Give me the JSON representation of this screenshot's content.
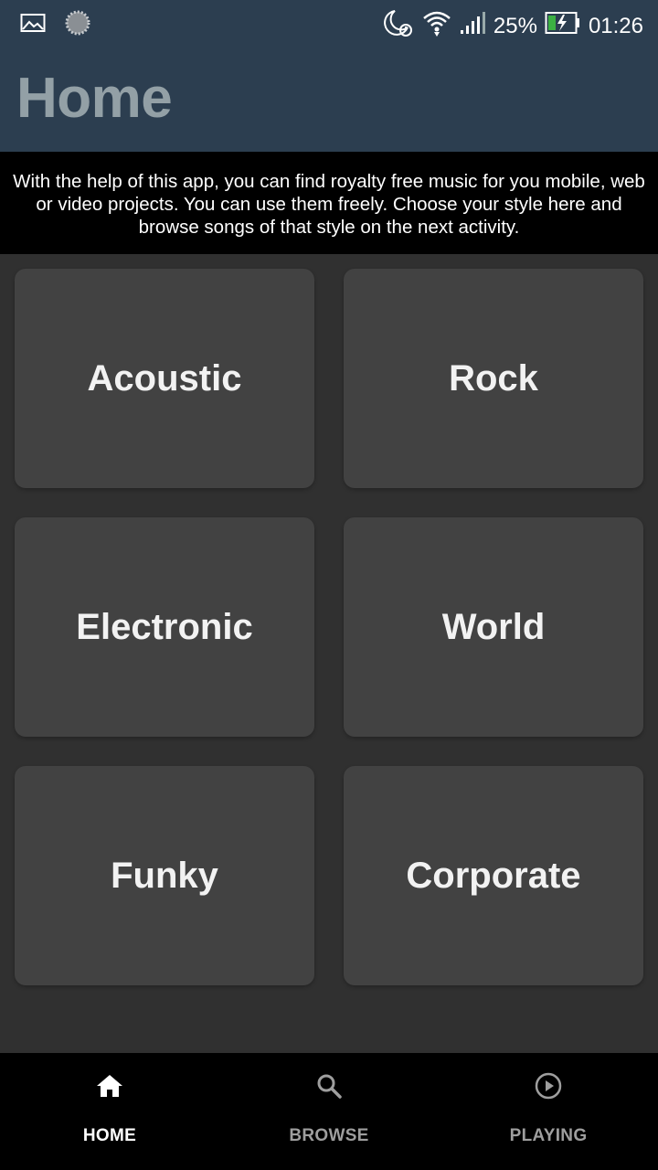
{
  "status_bar": {
    "battery": "25%",
    "time": "01:26",
    "icons": [
      "image-icon",
      "sync-icon",
      "moon-alarm-icon",
      "wifi-icon",
      "signal-icon",
      "battery-charging-icon"
    ]
  },
  "app_bar": {
    "title": "Home"
  },
  "intro_text": "With the help of this app, you can find royalty free music for you mobile, web or video projects. You can use them freely. Choose your style here and browse songs of that style on the next activity.",
  "genres": [
    {
      "label": "Acoustic"
    },
    {
      "label": "Rock"
    },
    {
      "label": "Electronic"
    },
    {
      "label": "World"
    },
    {
      "label": "Funky"
    },
    {
      "label": "Corporate"
    }
  ],
  "bottom_nav": {
    "items": [
      {
        "label": "HOME",
        "icon": "home-icon",
        "active": true
      },
      {
        "label": "BROWSE",
        "icon": "search-icon",
        "active": false
      },
      {
        "label": "PLAYING",
        "icon": "play-circle-icon",
        "active": false
      }
    ]
  },
  "colors": {
    "header_bg": "#2c3e50",
    "title_color": "#93a0a6",
    "card_bg": "#424242",
    "page_bg": "#303030"
  }
}
